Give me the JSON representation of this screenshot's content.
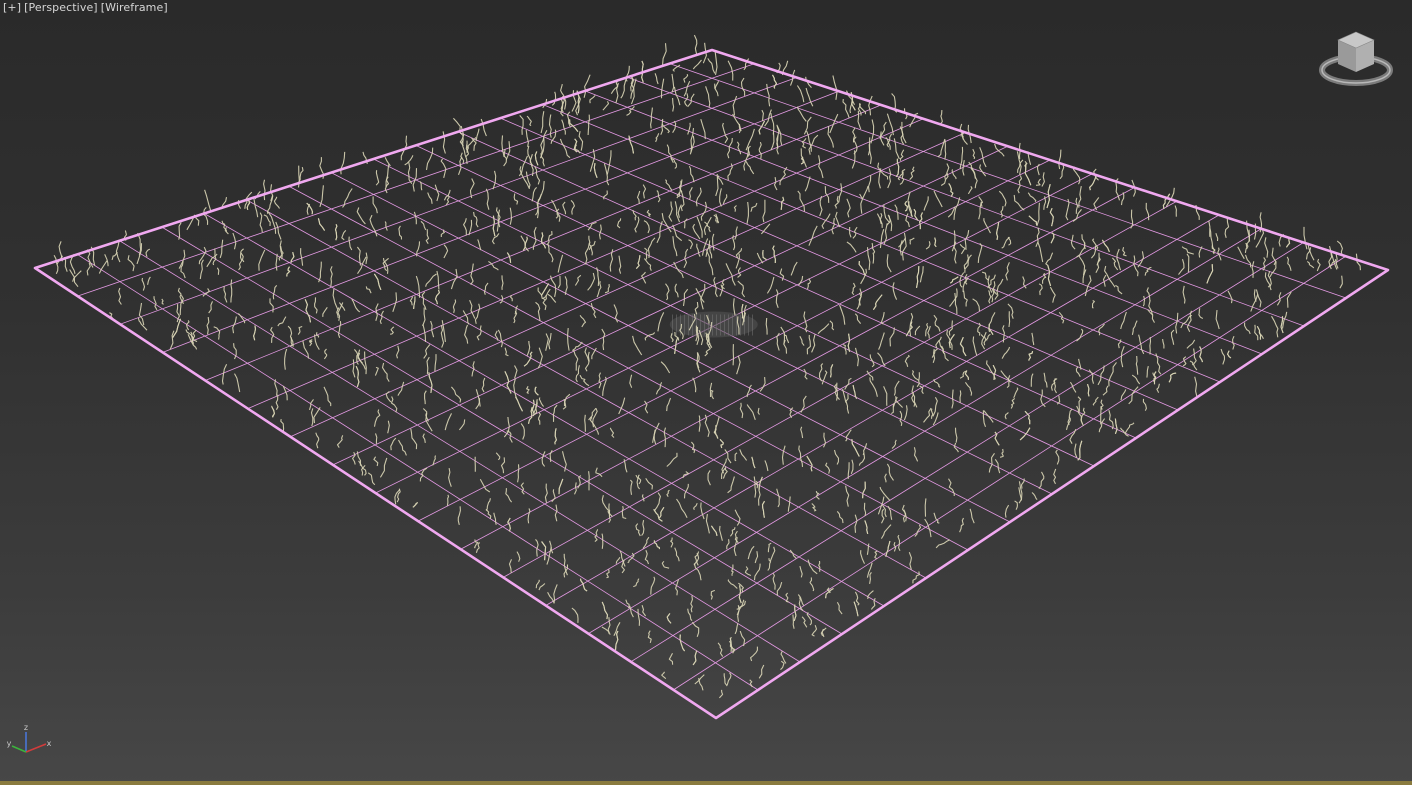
{
  "viewport": {
    "label_plus": "[+]",
    "label_view": "[Perspective]",
    "label_shading": "[Wireframe]"
  },
  "colors": {
    "plane_wire": "#e49ae4",
    "plane_border": "#f0a8f0",
    "hair_strands": "#d8d4b4",
    "background_top": "#2a2a2a",
    "background_bottom": "#474747",
    "axis_x": "#d23c3c",
    "axis_y": "#3cb43c",
    "axis_z": "#4a78e0"
  },
  "axis_tripod": {
    "x_label": "x",
    "y_label": "y",
    "z_label": "z"
  },
  "icons": {
    "viewcube": "viewcube-icon",
    "axis": "axis-tripod-icon"
  }
}
